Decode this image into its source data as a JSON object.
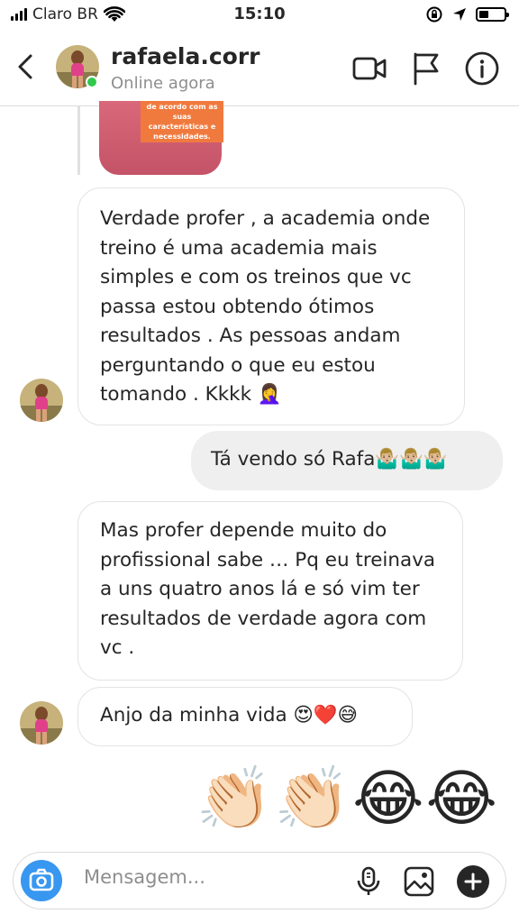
{
  "status_bar": {
    "carrier": "Claro BR",
    "time": "15:10",
    "icons": [
      "signal-icon",
      "wifi-icon",
      "rotation-lock-icon",
      "location-icon",
      "battery-icon"
    ]
  },
  "header": {
    "username": "rafaela.corr",
    "status": "Online agora",
    "online_color": "#31c94d",
    "icons": [
      "back-icon",
      "video-call-icon",
      "flag-icon",
      "info-icon"
    ]
  },
  "shared_post": {
    "caption": "de acordo com as suas características e necessidades."
  },
  "messages": [
    {
      "from": "them",
      "text": "Verdade profer , a academia onde treino é uma academia mais simples e com os treinos que vc passa estou obtendo ótimos resultados . As pessoas andam perguntando o que eu estou tomando . Kkkk 🤦‍♀️"
    },
    {
      "from": "me",
      "text": "Tá vendo só Rafa🤷🏼‍♂️🤷🏼‍♂️🤷🏼‍♂️"
    },
    {
      "from": "them",
      "text": "Mas profer depende muito do profissional sabe … Pq eu treinava a uns quatro anos lá e só vim ter resultados de verdade agora com vc ."
    },
    {
      "from": "them",
      "text": "Anjo da minha vida 😍❤️😅"
    },
    {
      "from": "me",
      "text": "👏🏻👏🏻😂😂"
    }
  ],
  "composer": {
    "placeholder": "Mensagem...",
    "accent": "#3897f0",
    "icons": [
      "camera-icon",
      "microphone-icon",
      "gallery-icon",
      "add-icon"
    ]
  }
}
